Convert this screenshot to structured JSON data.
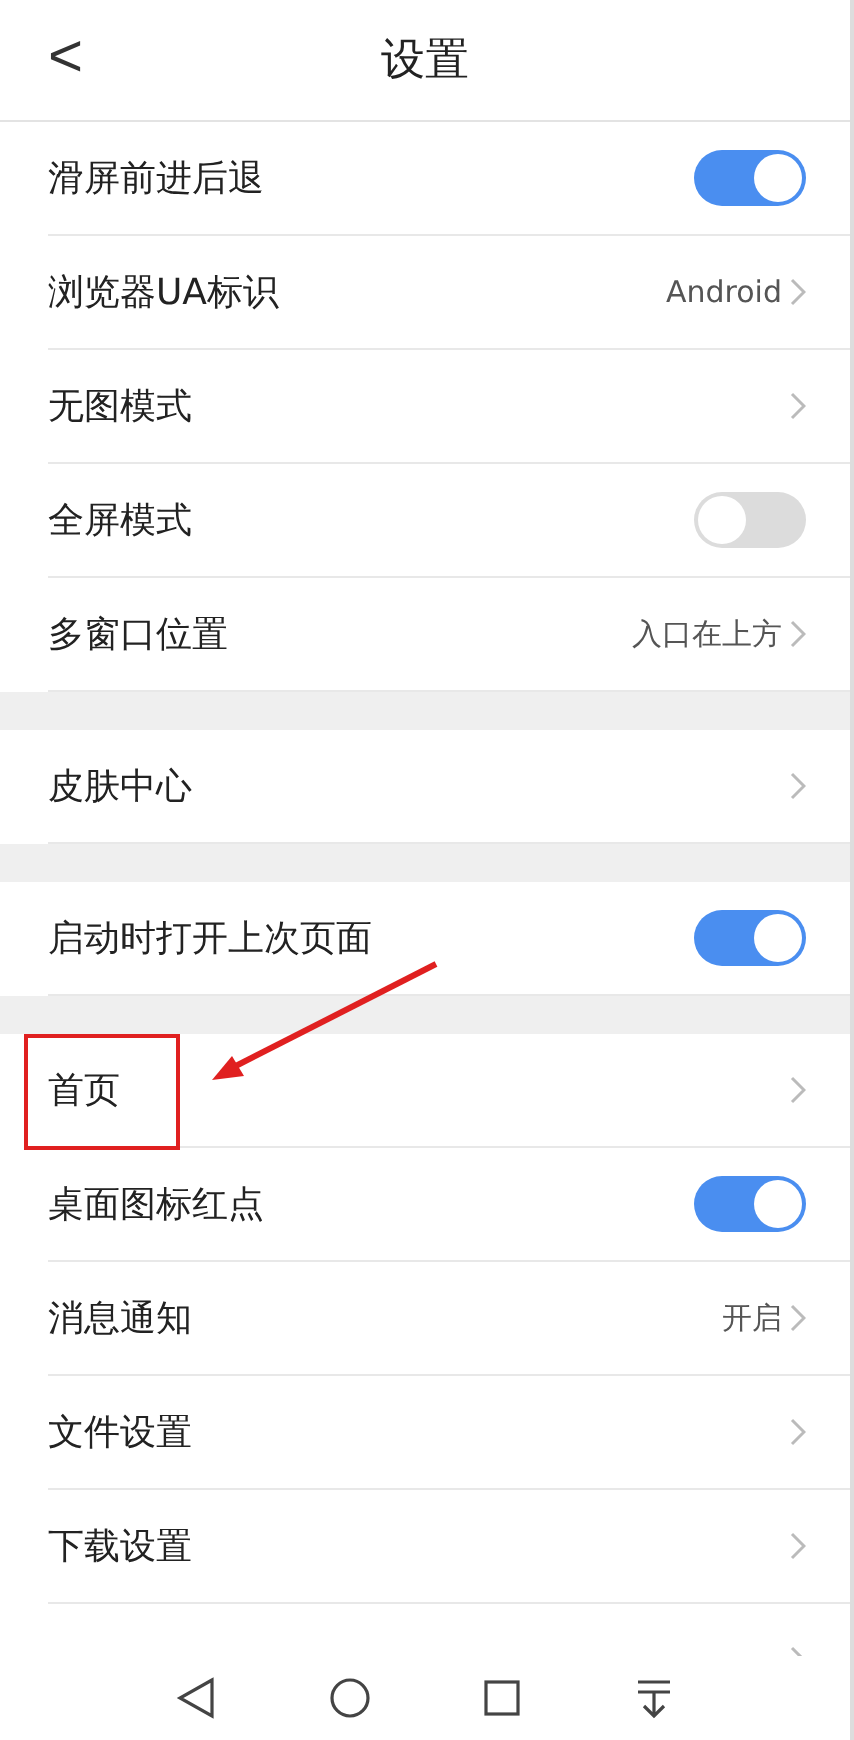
{
  "header": {
    "back": "<",
    "title": "设置"
  },
  "groups": [
    {
      "items": [
        {
          "kind": "toggle",
          "label": "滑屏前进后退",
          "on": true
        },
        {
          "kind": "link",
          "label": "浏览器UA标识",
          "value": "Android"
        },
        {
          "kind": "link",
          "label": "无图模式"
        },
        {
          "kind": "toggle",
          "label": "全屏模式",
          "on": false
        },
        {
          "kind": "link",
          "label": "多窗口位置",
          "value": "入口在上方"
        }
      ]
    },
    {
      "items": [
        {
          "kind": "link",
          "label": "皮肤中心"
        }
      ]
    },
    {
      "items": [
        {
          "kind": "toggle",
          "label": "启动时打开上次页面",
          "on": true
        }
      ]
    },
    {
      "items": [
        {
          "kind": "link",
          "label": "首页",
          "highlighted": true
        },
        {
          "kind": "toggle",
          "label": "桌面图标红点",
          "on": true
        },
        {
          "kind": "link",
          "label": "消息通知",
          "value": "开启"
        },
        {
          "kind": "link",
          "label": "文件设置"
        },
        {
          "kind": "link",
          "label": "下载设置"
        },
        {
          "kind": "link"
        }
      ]
    }
  ]
}
